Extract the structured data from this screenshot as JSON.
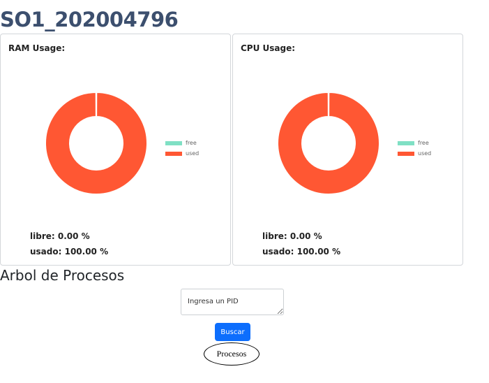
{
  "app": {
    "title": "SO1_202004796"
  },
  "colors": {
    "free": "#7fe0c4",
    "used": "#ff5733",
    "button": "#0d6efd"
  },
  "ram": {
    "title": "RAM Usage:",
    "libre_text": "libre: 0.00 %",
    "usado_text": "usado: 100.00 %",
    "legend": [
      "free",
      "used"
    ]
  },
  "cpu": {
    "title": "CPU Usage:",
    "libre_text": "libre: 0.00 %",
    "usado_text": "usado: 100.00 %",
    "legend": [
      "free",
      "used"
    ]
  },
  "chart_data": [
    {
      "type": "pie",
      "categories": [
        "free",
        "used"
      ],
      "values": [
        0.0,
        100.0
      ],
      "title": "RAM Usage:",
      "legend": "right"
    },
    {
      "type": "pie",
      "categories": [
        "free",
        "used"
      ],
      "values": [
        0.0,
        100.0
      ],
      "title": "CPU Usage:",
      "legend": "right"
    }
  ],
  "tree": {
    "title": "Arbol de Procesos",
    "pid_placeholder": "Ingresa un PID",
    "search_label": "Buscar",
    "root_node": "Procesos"
  }
}
